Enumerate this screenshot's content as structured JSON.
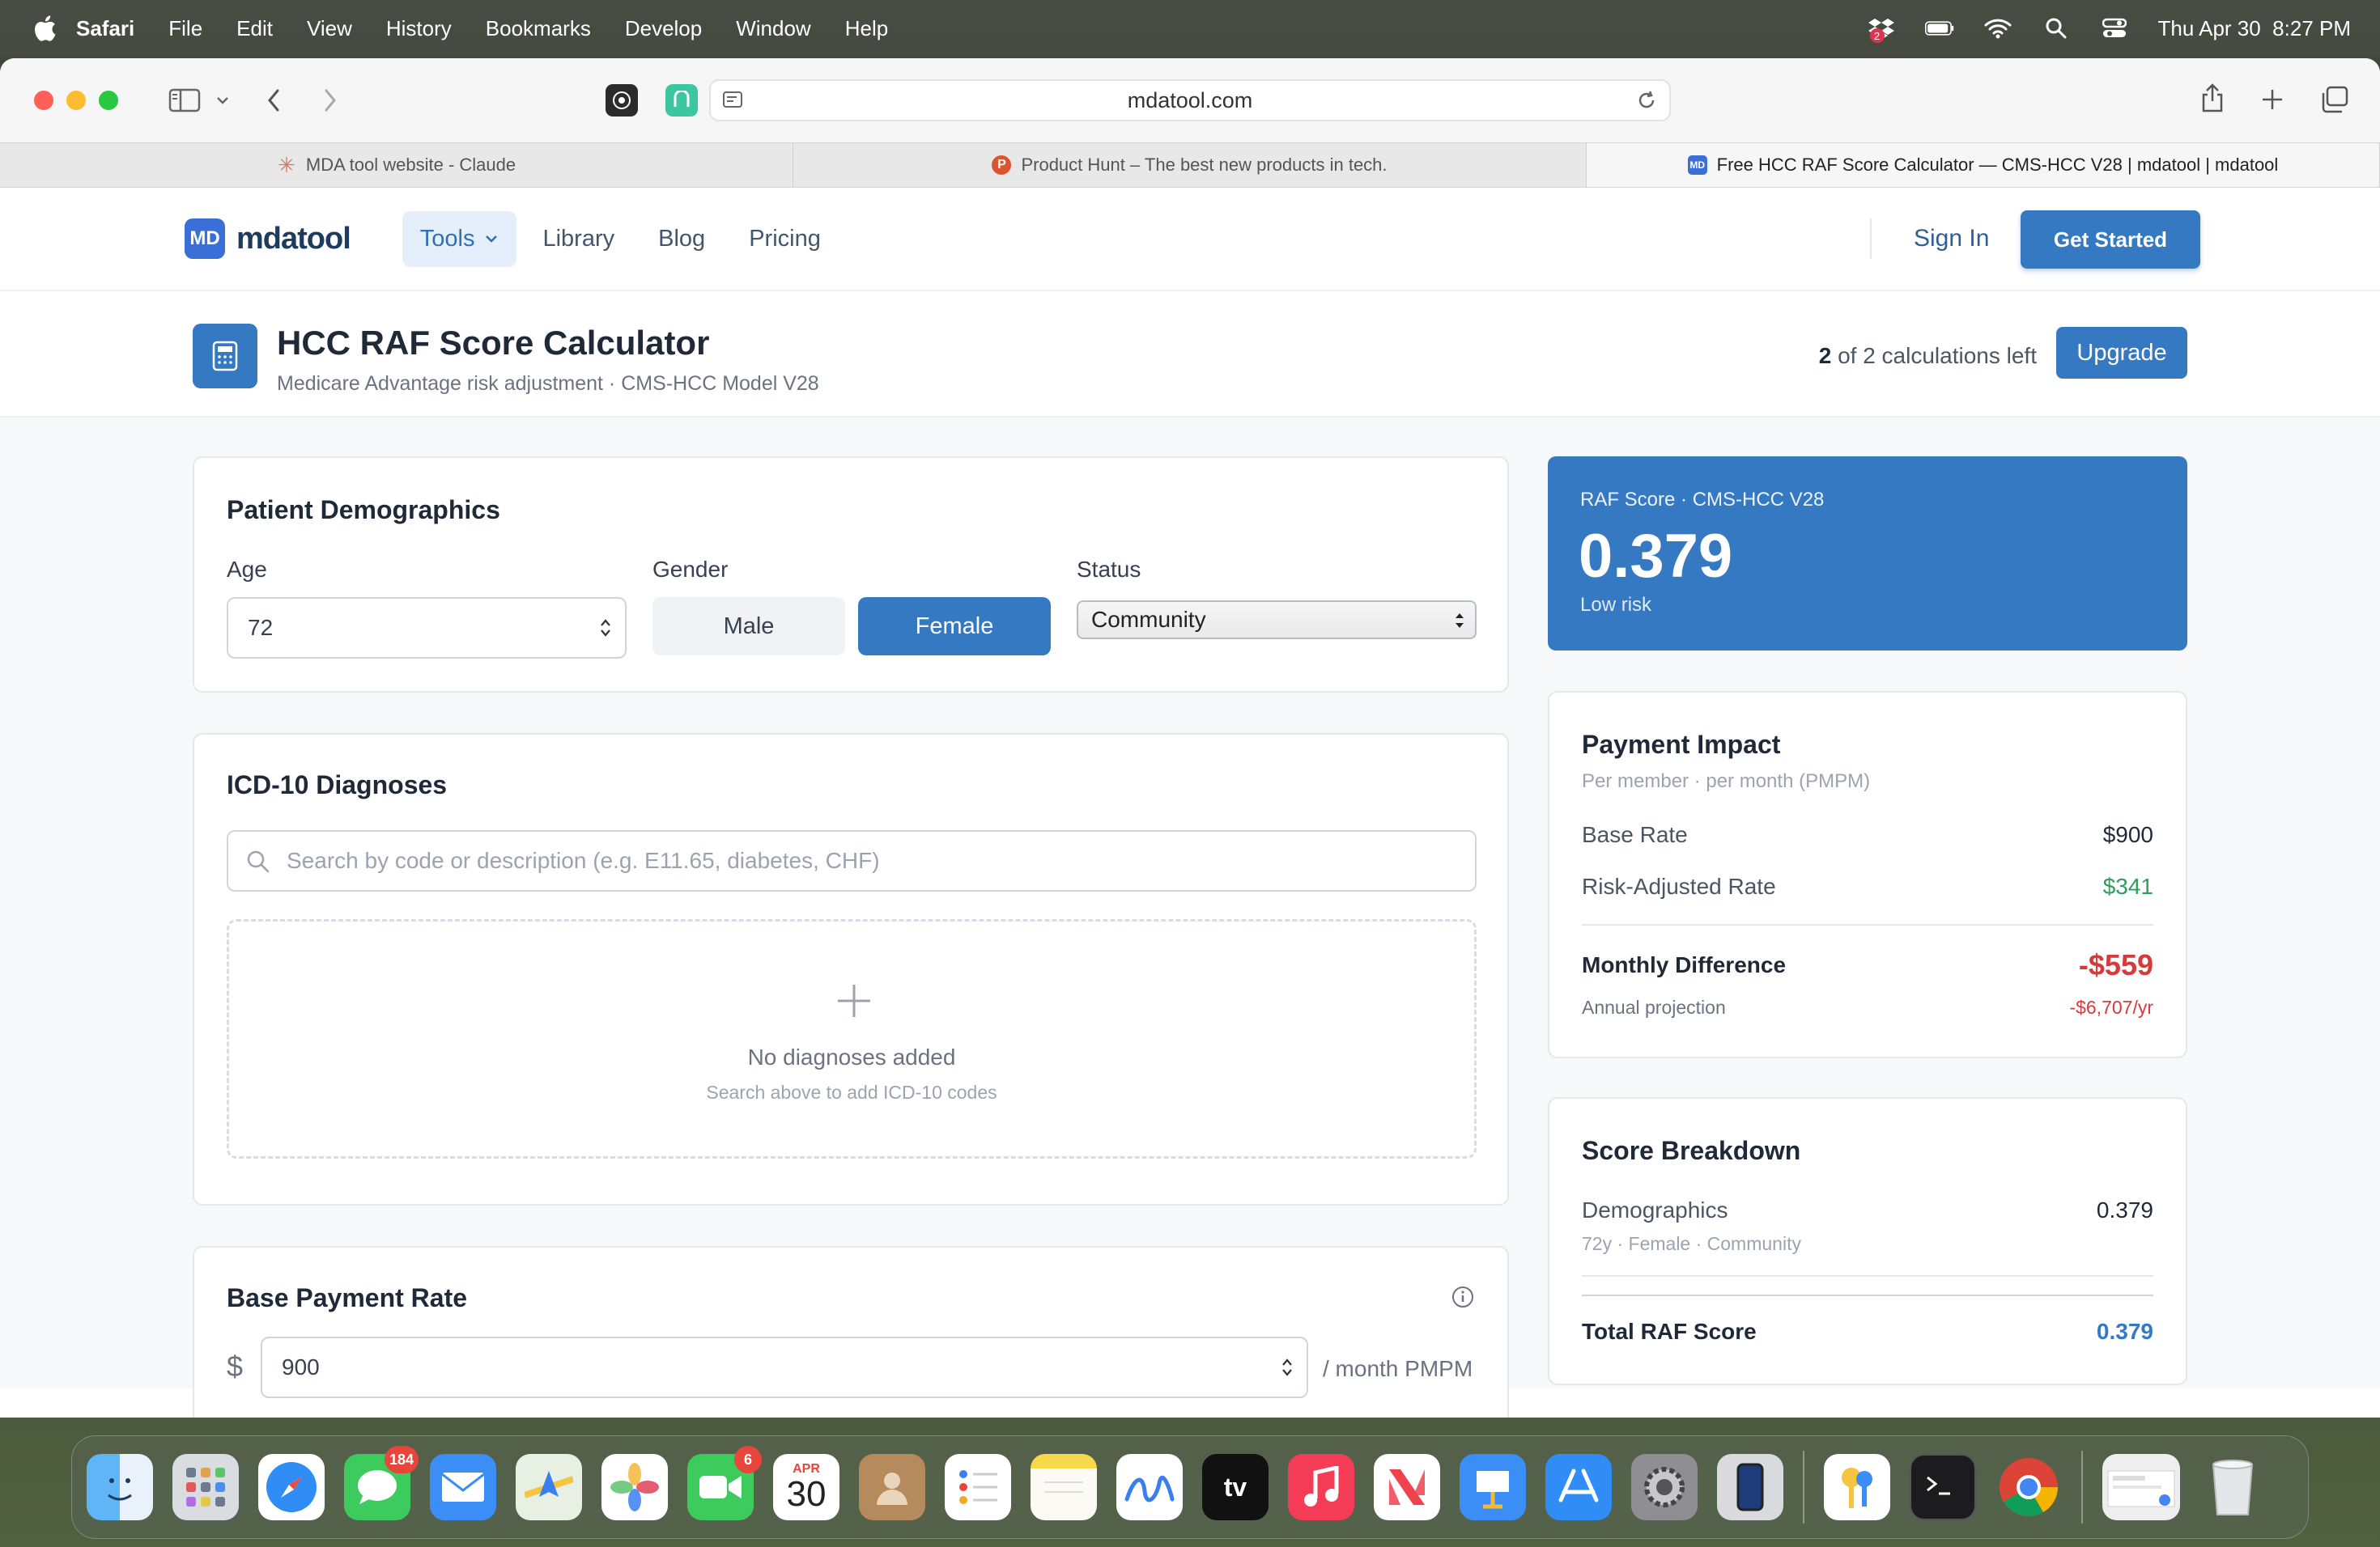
{
  "menubar": {
    "app": "Safari",
    "items": [
      "File",
      "Edit",
      "View",
      "History",
      "Bookmarks",
      "Develop",
      "Window",
      "Help"
    ],
    "datetime": "Thu Apr 30  8:27 PM",
    "dropbox_badge": "2"
  },
  "browser": {
    "url": "mdatool.com",
    "tabs": [
      {
        "title": "MDA tool website - Claude",
        "icon": "claude-icon"
      },
      {
        "title": "Product Hunt – The best new products in tech.",
        "icon": "product-hunt-icon"
      },
      {
        "title": "Free HCC RAF Score Calculator — CMS-HCC V28 | mdatool | mdatool",
        "icon": "mdatool-icon"
      }
    ]
  },
  "site": {
    "logo_mark": "MD",
    "logo_text": "mdatool",
    "nav": {
      "tools": "Tools",
      "library": "Library",
      "blog": "Blog",
      "pricing": "Pricing"
    },
    "sign_in": "Sign In",
    "get_started": "Get Started"
  },
  "tool": {
    "title": "HCC RAF Score Calculator",
    "subtitle": "Medicare Advantage risk adjustment · CMS-HCC Model V28",
    "calcs_count": "2",
    "calcs_text": " of 2 calculations left",
    "upgrade": "Upgrade"
  },
  "demographics": {
    "heading": "Patient Demographics",
    "age_label": "Age",
    "age_value": "72",
    "gender_label": "Gender",
    "male": "Male",
    "female": "Female",
    "status_label": "Status",
    "status_value": "Community"
  },
  "diagnoses": {
    "heading": "ICD-10 Diagnoses",
    "search_placeholder": "Search by code or description (e.g. E11.65, diabetes, CHF)",
    "empty_title": "No diagnoses added",
    "empty_sub": "Search above to add ICD-10 codes"
  },
  "base_payment": {
    "heading": "Base Payment Rate",
    "currency": "$",
    "value": "900",
    "unit": "/ month PMPM"
  },
  "raf": {
    "label": "RAF Score · CMS-HCC V28",
    "score": "0.379",
    "risk": "Low risk"
  },
  "payment_impact": {
    "heading": "Payment Impact",
    "sub": "Per member · per month (PMPM)",
    "base_rate_label": "Base Rate",
    "base_rate_value": "$900",
    "risk_adj_label": "Risk-Adjusted Rate",
    "risk_adj_value": "$341",
    "monthly_diff_label": "Monthly Difference",
    "monthly_diff_value": "-$559",
    "annual_label": "Annual projection",
    "annual_value": "-$6,707/yr"
  },
  "breakdown": {
    "heading": "Score Breakdown",
    "demo_label": "Demographics",
    "demo_value": "0.379",
    "demo_sub": "72y · Female · Community",
    "total_label": "Total RAF Score",
    "total_value": "0.379"
  },
  "dock": {
    "messages_badge": "184",
    "facetime_badge": "6",
    "calendar_month": "APR",
    "calendar_day": "30"
  },
  "colors": {
    "primary": "#3579c3",
    "positive": "#2e9d5b",
    "negative": "#d63a3a"
  }
}
